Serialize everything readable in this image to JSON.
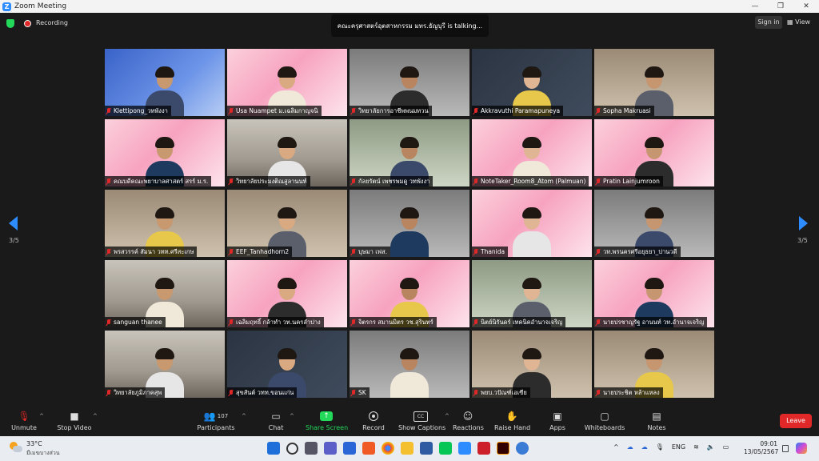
{
  "window": {
    "title": "Zoom Meeting",
    "controls": [
      "—",
      "❐",
      "✕"
    ]
  },
  "infobar": {
    "recording_label": "Recording",
    "talking": "คณะครุศาสตร์อุตสาหกรรม มทร.ธัญบุรี is talking...",
    "sign_in": "Sign in",
    "view": "View"
  },
  "pagination": {
    "left": "3/5",
    "right": "3/5"
  },
  "participants": [
    {
      "name": "Klettipong_วทพังงา",
      "bg": "blue"
    },
    {
      "name": "Usa Nuampet ม.เฉลิมกาญจนิ",
      "bg": "pink"
    },
    {
      "name": "วิทยาลัยการอาชีพพนมทวน",
      "bg": "gray"
    },
    {
      "name": "Akkravuthi Paramapuneya",
      "bg": "dark"
    },
    {
      "name": "Sopha Makruasi",
      "bg": "office"
    },
    {
      "name": "คณบดีคณะพยาบาลศาสตร์ สรร์ ม.ร.",
      "bg": "pink"
    },
    {
      "name": "วิทยาลัยประมงติณสูลานนท์",
      "bg": "room"
    },
    {
      "name": "กัลยรัตน์ เพชรพมดู วทพังงา",
      "bg": "green"
    },
    {
      "name": "NoteTaker_Room8_Atom (Palmuan)",
      "bg": "pink"
    },
    {
      "name": "Pratin Lainjumroon",
      "bg": "pink"
    },
    {
      "name": "พรสวรรค์ สัมนา วทท.ศรีสะเกษ",
      "bg": "office"
    },
    {
      "name": "EEF_Tanhadhorn2",
      "bg": "office"
    },
    {
      "name": "บุษมา เฟส.",
      "bg": "gray"
    },
    {
      "name": "Thanida",
      "bg": "pink"
    },
    {
      "name": "วท.พรนครศรีอยุธยา_ปานวดี",
      "bg": "gray"
    },
    {
      "name": "sanguan thanee",
      "bg": "room"
    },
    {
      "name": "เฉลิมฤทธิ์ กล้าทำ วท.นครลำปาง",
      "bg": "pink"
    },
    {
      "name": "จิตรกร สมานมิตร วช.สุรินทร์",
      "bg": "pink"
    },
    {
      "name": "นิตย์นิรันดร์ เทคนิคอำนาจเจริญ",
      "bg": "green"
    },
    {
      "name": "นายปรชาญรัฐ อานนท์ วท.อำนาจเจริญ",
      "bg": "pink"
    },
    {
      "name": "วิทยาลัยภูมิภาคสุพ",
      "bg": "room"
    },
    {
      "name": "สุขสันต์ วทท.ขอนแก่น",
      "bg": "dark"
    },
    {
      "name": "SK",
      "bg": "gray"
    },
    {
      "name": "พยบ.วปัณฑ์เอเซีย",
      "bg": "office"
    },
    {
      "name": "นายประชิต หล้าแหลง",
      "bg": "office"
    }
  ],
  "toolbar": {
    "unmute": "Unmute",
    "stop_video": "Stop Video",
    "participants_count": "107",
    "participants": "Participants",
    "chat": "Chat",
    "share_screen": "Share Screen",
    "record": "Record",
    "show_captions": "Show Captions",
    "reactions": "Reactions",
    "raise_hand": "Raise Hand",
    "apps": "Apps",
    "whiteboards": "Whiteboards",
    "notes": "Notes",
    "leave": "Leave"
  },
  "taskbar": {
    "temperature": "33°C",
    "weather": "มีเมฆบางส่วน",
    "lang": "ENG",
    "time": "09:01",
    "date": "13/05/2567"
  },
  "colors": {
    "zoom_blue": "#2d8cff",
    "leave_red": "#e02828",
    "share_green": "#23d959"
  }
}
